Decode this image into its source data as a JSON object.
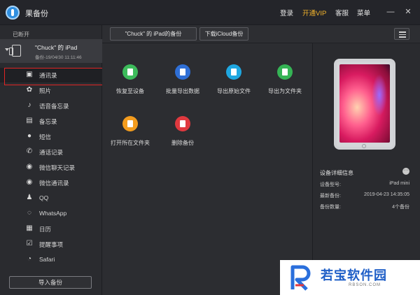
{
  "app": {
    "title": "果备份"
  },
  "topnav": {
    "login": "登录",
    "vip": "开通VIP",
    "service": "客服",
    "menu": "菜单"
  },
  "sidebar": {
    "status": "已断开",
    "device": {
      "name": "\"Chuck\" 的 iPad",
      "backup": "备份-19/04/30 11:11:46"
    },
    "items": [
      {
        "label": "通讯录",
        "icon": "contacts-icon"
      },
      {
        "label": "照片",
        "icon": "photos-icon"
      },
      {
        "label": "语音备忘录",
        "icon": "microphone-icon"
      },
      {
        "label": "备忘录",
        "icon": "notes-icon"
      },
      {
        "label": "短信",
        "icon": "message-icon"
      },
      {
        "label": "通话记录",
        "icon": "phone-icon"
      },
      {
        "label": "微信聊天记录",
        "icon": "wechat-icon"
      },
      {
        "label": "微信通讯录",
        "icon": "wechat-contacts-icon"
      },
      {
        "label": "QQ",
        "icon": "qq-icon"
      },
      {
        "label": "WhatsApp",
        "icon": "whatsapp-icon"
      },
      {
        "label": "日历",
        "icon": "calendar-icon"
      },
      {
        "label": "提醒事项",
        "icon": "reminders-icon"
      },
      {
        "label": "Safari",
        "icon": "safari-icon"
      }
    ],
    "import_button": "导入备份"
  },
  "toolbar": {
    "backup_tab": "\"Chuck\" 的 iPad的备份",
    "icloud_button": "下载iCloud备份"
  },
  "actions": [
    {
      "label": "恢复至设备",
      "color": "#3dbb5b"
    },
    {
      "label": "批量导出数据",
      "color": "#2f6fd6"
    },
    {
      "label": "导出原始文件",
      "color": "#1fa7e0"
    },
    {
      "label": "导出为文件夹",
      "color": "#35b455"
    },
    {
      "label": "打开所在文件夹",
      "color": "#f39c1e"
    },
    {
      "label": "删除备份",
      "color": "#e0393f"
    }
  ],
  "device_info": {
    "title": "设备详细信息",
    "rows": [
      {
        "key": "设备型号:",
        "value": "iPad mini"
      },
      {
        "key": "最新备份:",
        "value": "2019-04-23 14:35:05"
      },
      {
        "key": "备份数量:",
        "value": "4个备份"
      }
    ]
  },
  "watermark": {
    "text": "若宝软件园",
    "sub": "RBSON.COM"
  }
}
